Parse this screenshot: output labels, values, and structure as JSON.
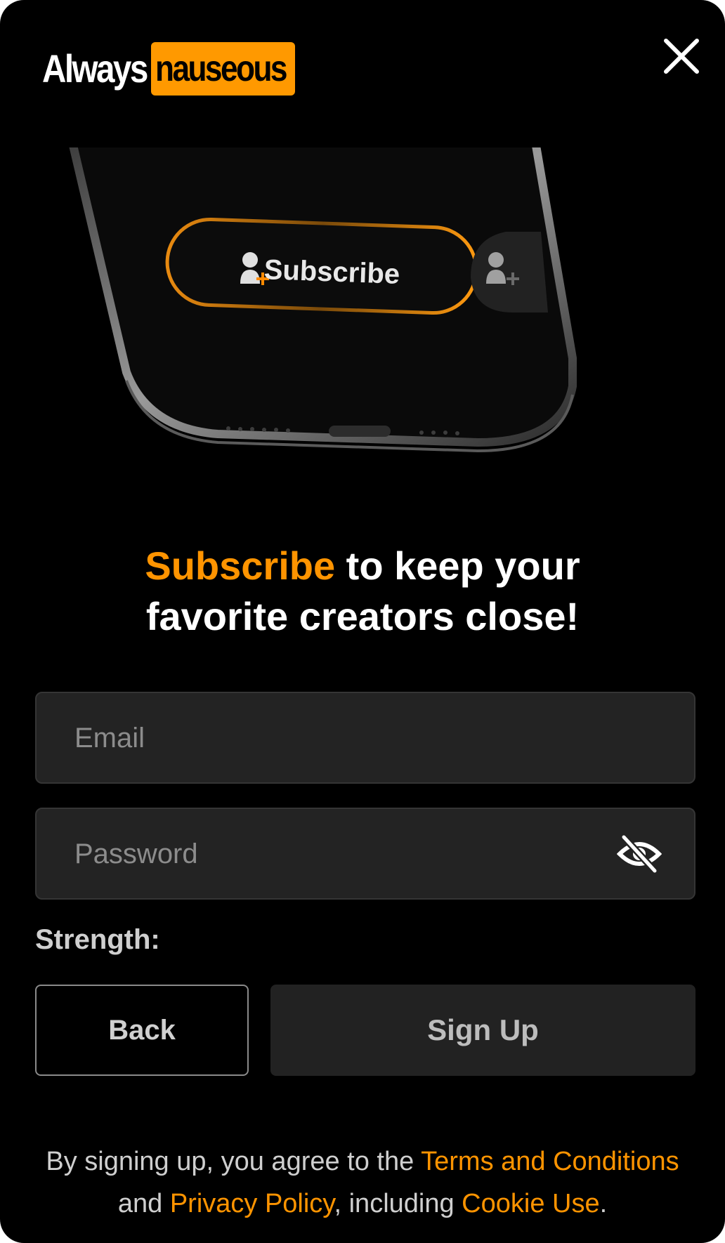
{
  "logo": {
    "left": "Always",
    "right": "nauseous"
  },
  "hero": {
    "button_label": "Subscribe"
  },
  "headline": {
    "accent": "Subscribe",
    "line1_rest": " to keep your",
    "line2": "favorite creators close!"
  },
  "form": {
    "email_placeholder": "Email",
    "email_value": "",
    "password_placeholder": "Password",
    "password_value": "",
    "strength_label": "Strength:"
  },
  "buttons": {
    "back": "Back",
    "signup": "Sign Up"
  },
  "legal": {
    "prefix": "By signing up, you agree to the ",
    "terms": "Terms and Conditions",
    "and": "and ",
    "privacy": "Privacy Policy",
    "including": ", including ",
    "cookie": "Cookie Use",
    "period": "."
  },
  "colors": {
    "accent": "#ff9400",
    "background": "#000000",
    "field": "#232323"
  },
  "icons": {
    "close": "close-icon",
    "eye": "eye-slash-icon",
    "add_user": "add-user-icon"
  }
}
